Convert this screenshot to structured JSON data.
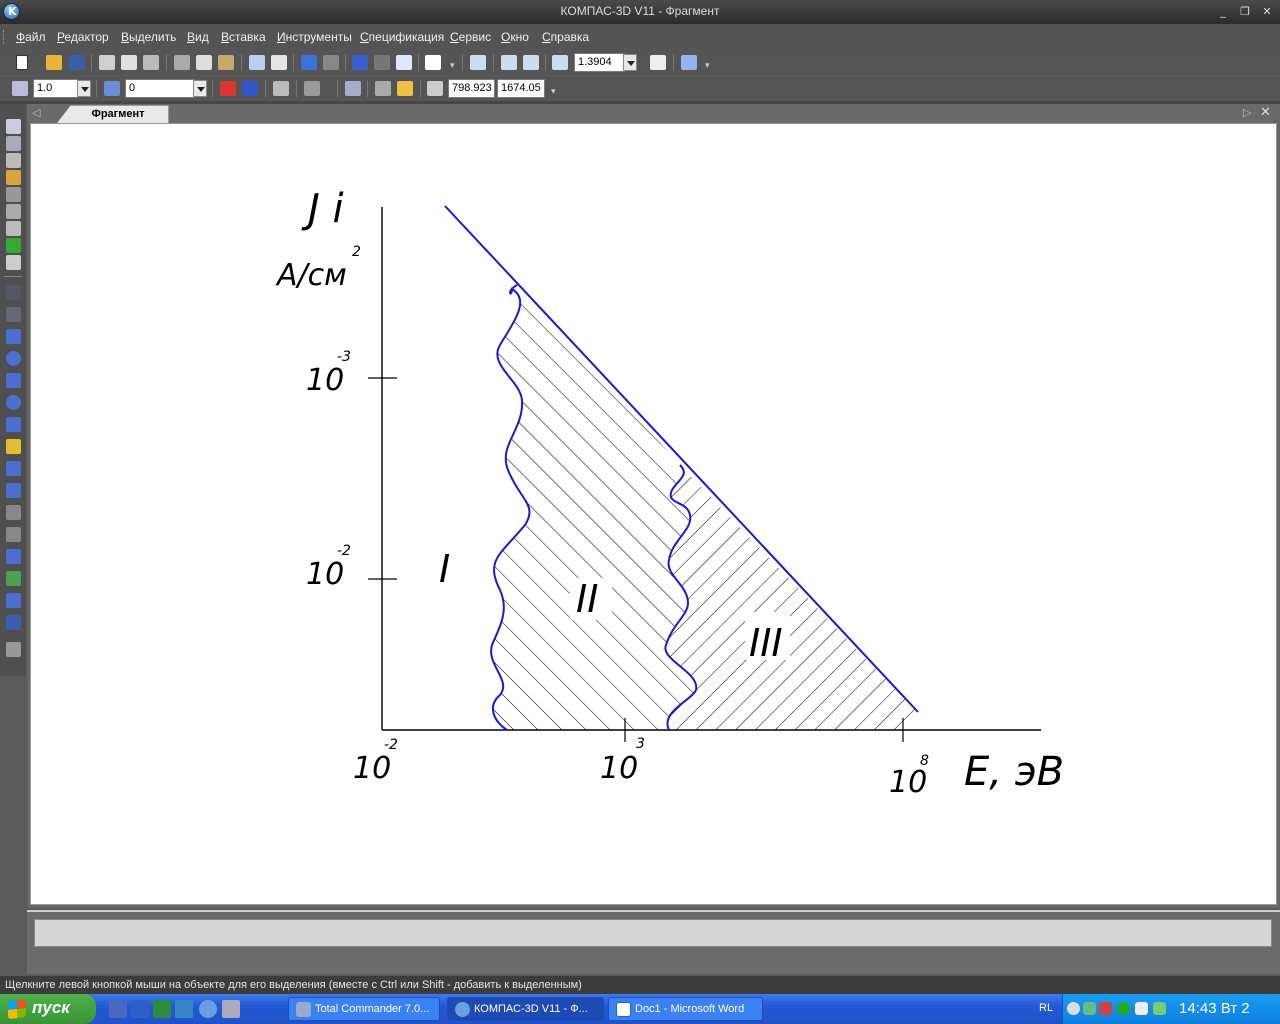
{
  "window": {
    "title": "КОМПАС-3D V11 - Фрагмент",
    "minimize": "_",
    "maximize": "❐",
    "close": "✕"
  },
  "menu": [
    "Файл",
    "Редактор",
    "Выделить",
    "Вид",
    "Вставка",
    "Инструменты",
    "Спецификация",
    "Сервис",
    "Окно",
    "Справка"
  ],
  "toolbar1": {
    "zoom_value": "1.3904"
  },
  "toolbar2": {
    "step_value": "1.0",
    "layer_value": "0",
    "coord_x": "798.923",
    "coord_y": "1674.05"
  },
  "document": {
    "tab_label": "Фрагмент"
  },
  "drawing": {
    "y_axis_label": "J i",
    "y_unit": "A/см",
    "y_unit_exp": "2",
    "y_ticks": [
      {
        "base": "10",
        "exp": "-3"
      },
      {
        "base": "10",
        "exp": "-2"
      }
    ],
    "x_ticks": [
      {
        "base": "10",
        "exp": "-2"
      },
      {
        "base": "10",
        "exp": "3"
      },
      {
        "base": "10",
        "exp": "8"
      }
    ],
    "x_axis_label": "E, эВ",
    "regions": [
      "I",
      "II",
      "III"
    ],
    "line_color": "#1a1ad2"
  },
  "status_text": "Щелкните левой кнопкой мыши на объекте для его выделения (вместе с Ctrl или Shift - добавить к выделенным)",
  "taskbar": {
    "start_label": "пуск",
    "tasks": [
      "Total Commander 7.0...",
      "КОМПАС-3D V11 - Ф...",
      "Doc1 - Microsoft Word"
    ],
    "lang": "RL",
    "clock": "14:43 Вт 2"
  }
}
